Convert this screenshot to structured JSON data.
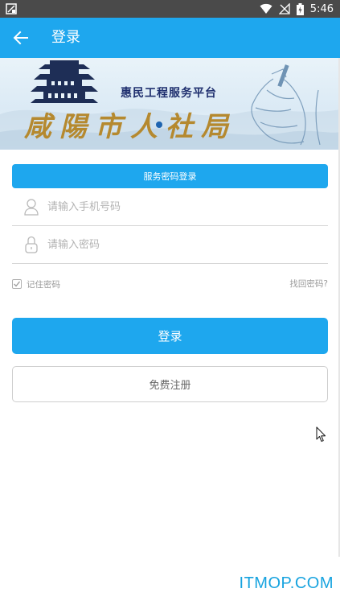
{
  "status_bar": {
    "time": "5:46"
  },
  "app_bar": {
    "title": "登录",
    "back_icon": "arrow-left-icon",
    "color": "#1ea7ee"
  },
  "banner": {
    "subtitle": "惠民工程服务平台",
    "calligraphy": "咸陽市人社局"
  },
  "form": {
    "tab_label": "服务密码登录",
    "phone_placeholder": "请输入手机号码",
    "password_placeholder": "请输入密码",
    "remember_label": "记住密码",
    "remember_checked": true,
    "forgot_label": "找回密码?",
    "login_label": "登录",
    "register_label": "免费注册"
  },
  "watermark": "ITMOP.COM",
  "colors": {
    "primary": "#1ea7ee",
    "status_bar": "#4a4a4a",
    "placeholder": "#b3b3b3"
  }
}
